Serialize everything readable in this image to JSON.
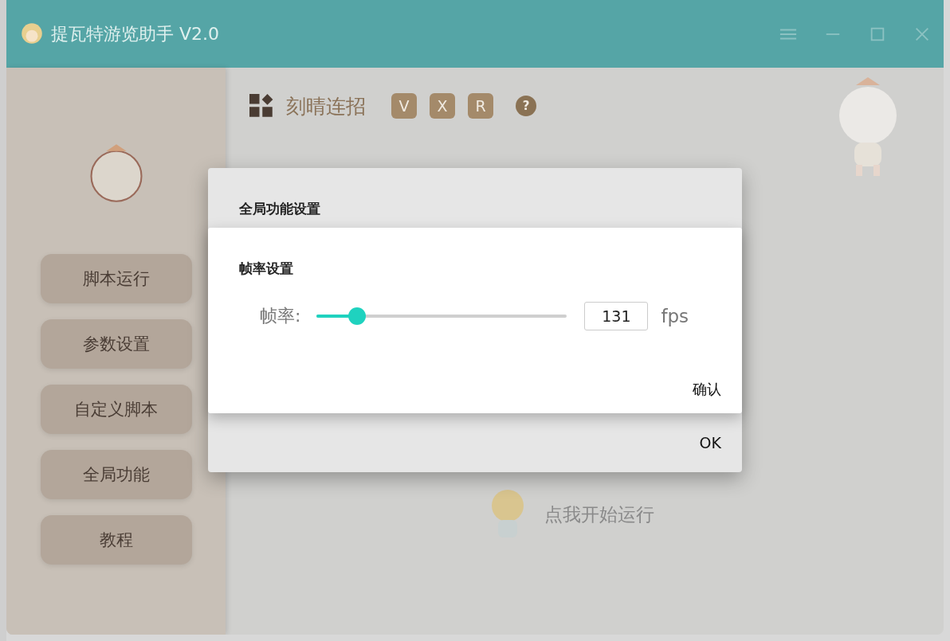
{
  "window": {
    "title": "提瓦特游览助手 V2.0"
  },
  "sidebar": {
    "items": [
      {
        "label": "脚本运行"
      },
      {
        "label": "参数设置"
      },
      {
        "label": "自定义脚本"
      },
      {
        "label": "全局功能"
      },
      {
        "label": "教程"
      }
    ]
  },
  "header": {
    "title": "刻晴连招",
    "keys": [
      "V",
      "X",
      "R"
    ],
    "help": "?"
  },
  "run_button": {
    "label": "点我开始运行"
  },
  "dialog": {
    "title": "全局功能设置",
    "section": "帧率设置",
    "label": "帧率:",
    "level": 0.15,
    "value": "131",
    "unit": "fps",
    "confirm": "确认",
    "ok": "OK"
  }
}
